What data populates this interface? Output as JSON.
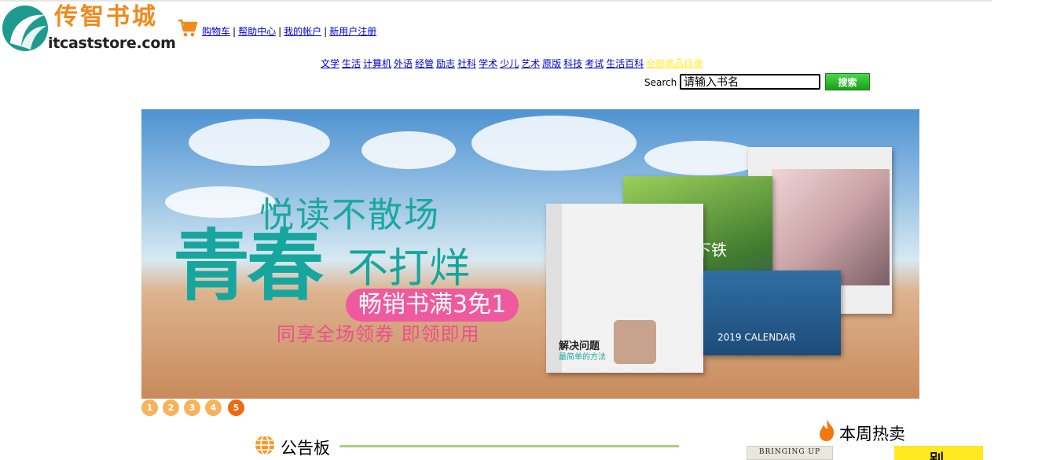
{
  "logo": {
    "chinese": "传智书城",
    "domain": "itcaststore.com"
  },
  "header": {
    "links": [
      "购物车",
      "帮助中心",
      "我的帐户",
      "新用户注册"
    ]
  },
  "categories": [
    "文学",
    "生活",
    "计算机",
    "外语",
    "经管",
    "励志",
    "社科",
    "学术",
    "少儿",
    "艺术",
    "原版",
    "科技",
    "考试",
    "生活百科",
    "全部商品目录"
  ],
  "search": {
    "label": "Search",
    "value": "请输入书名",
    "button": "搜索"
  },
  "banner": {
    "line1": "悦读不散场",
    "line2": "青春",
    "line3": "不打烊",
    "promo": "畅销书满3免1",
    "line4": "同享全场领券  即领即用",
    "book_titles": [
      "解决问题",
      "最简单的方法",
      "地下铁",
      "2019 CALENDAR"
    ]
  },
  "slider": {
    "pages": [
      "1",
      "2",
      "3",
      "4",
      "5"
    ],
    "active": 5
  },
  "bulletin": {
    "title": "公告板"
  },
  "hot": {
    "title": "本周热卖",
    "book1": "BRINGING UP BOYS",
    "book2": "别"
  },
  "colors": {
    "link": "#0000cc",
    "logo_orange": "#f08a1c",
    "teal": "#1ba79f",
    "pink": "#ee5a9d",
    "dot": "#f5b35c",
    "dot_active": "#ee6a10",
    "search_button": "#17a117",
    "divider": "#a8d27a"
  },
  "icons": {
    "cart": "shopping-cart-icon",
    "bulletin": "globe-icon",
    "hot": "flame-icon"
  }
}
